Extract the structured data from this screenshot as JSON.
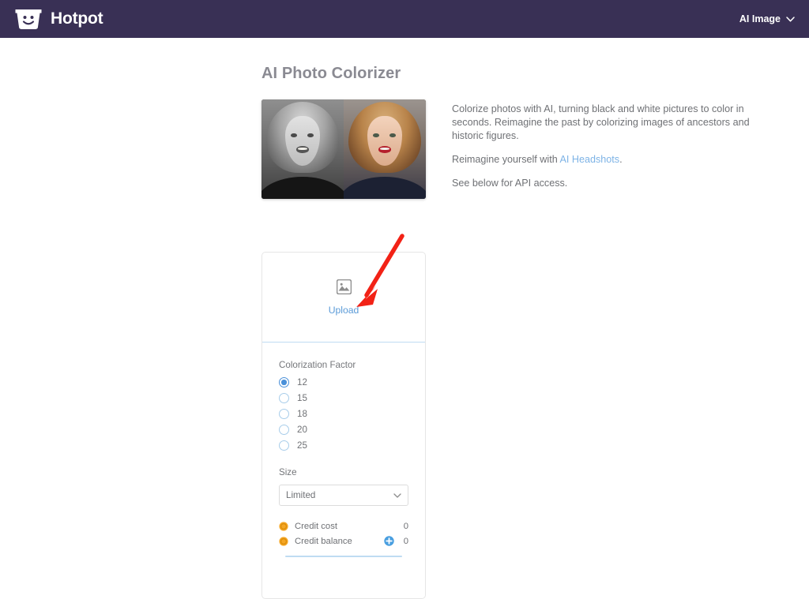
{
  "header": {
    "brand_name": "Hotpot",
    "logo_icon": "hotpot-smiley-pot-icon",
    "nav_label": "AI Image",
    "nav_chevron_icon": "chevron-down-icon",
    "background_color": "#393055"
  },
  "main": {
    "page_title": "AI Photo Colorizer",
    "hero": {
      "alt": "before-after-colorized-portrait",
      "left_label": "black-and-white",
      "right_label": "colorized"
    },
    "description": {
      "line1": "Colorize photos with AI, turning black and white pictures to color in seconds. Reimagine the past by colorizing images of ancestors and historic figures.",
      "line2_prefix": "Reimagine yourself with ",
      "line2_link": "AI Headshots",
      "line2_suffix": ".",
      "line3": "See below for API access."
    }
  },
  "tool_card": {
    "upload": {
      "icon": "image-placeholder-icon",
      "label": "Upload"
    },
    "colorization": {
      "label": "Colorization Factor",
      "options": [
        {
          "value": "12",
          "selected": true
        },
        {
          "value": "15",
          "selected": false
        },
        {
          "value": "18",
          "selected": false
        },
        {
          "value": "20",
          "selected": false
        },
        {
          "value": "25",
          "selected": false
        }
      ]
    },
    "size": {
      "label": "Size",
      "selected": "Limited",
      "chevron_icon": "chevron-down-icon"
    },
    "credits": {
      "cost_label": "Credit cost",
      "cost_value": "0",
      "balance_label": "Credit balance",
      "balance_value": "0",
      "coin_icon": "coin-icon",
      "add_credits_icon": "plus-circle-icon"
    }
  },
  "annotation": {
    "arrow_color": "#f22216",
    "arrow_description": "red-arrow-pointing-to-upload"
  },
  "colors": {
    "accent_blue": "#4a90d9",
    "link_blue": "#7db3e6",
    "header_purple": "#393055",
    "text_gray": "#6f7175",
    "coin_orange": "#f5a623"
  }
}
